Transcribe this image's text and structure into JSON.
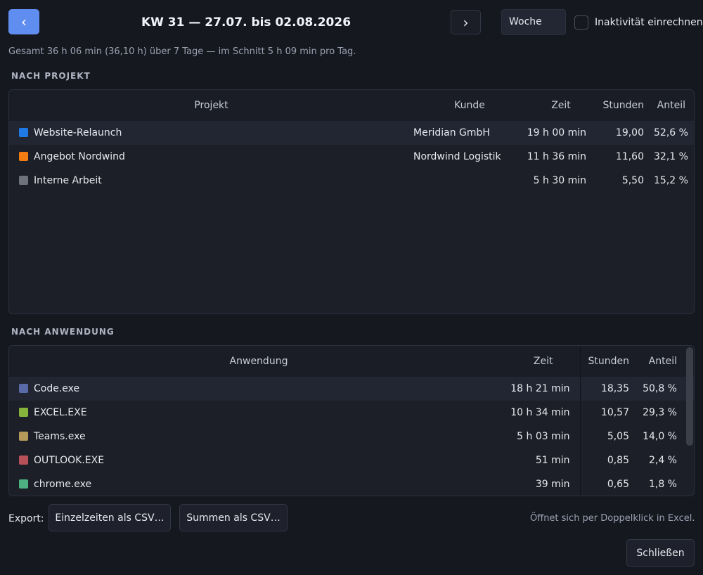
{
  "header": {
    "prev_icon": "‹",
    "next_icon": "›",
    "title": "KW 31 — 27.07. bis 02.08.2026",
    "period": "Woche",
    "inactivity_label": "Inaktivität einrechnen",
    "inactivity_checked": false
  },
  "summary": "Gesamt 36 h 06 min (36,10 h) über 7 Tage — im Schnitt 5 h 09 min pro Tag.",
  "projekt": {
    "section_title": "NACH PROJEKT",
    "columns": [
      "Projekt",
      "Kunde",
      "Zeit",
      "Stunden",
      "Anteil"
    ],
    "rows": [
      {
        "name": "Website-Relaunch",
        "color": "#1f7ae8",
        "kunde": "Meridian GmbH",
        "zeit": "19 h 00 min",
        "stunden": "19,00",
        "anteil": "52,6 %"
      },
      {
        "name": "Angebot Nordwind",
        "color": "#f07c12",
        "kunde": "Nordwind Logistik",
        "zeit": "11 h 36 min",
        "stunden": "11,60",
        "anteil": "32,1 %"
      },
      {
        "name": "Interne Arbeit",
        "color": "#6e727d",
        "kunde": "",
        "zeit": "5 h 30 min",
        "stunden": "5,50",
        "anteil": "15,2 %"
      }
    ]
  },
  "anwendung": {
    "section_title": "NACH ANWENDUNG",
    "columns": [
      "Anwendung",
      "Zeit",
      "Stunden",
      "Anteil"
    ],
    "rows": [
      {
        "name": "Code.exe",
        "color": "#5a6aa8",
        "zeit": "18 h 21 min",
        "stunden": "18,35",
        "anteil": "50,8 %"
      },
      {
        "name": "EXCEL.EXE",
        "color": "#86b33c",
        "zeit": "10 h 34 min",
        "stunden": "10,57",
        "anteil": "29,3 %"
      },
      {
        "name": "Teams.exe",
        "color": "#b59a5a",
        "zeit": "5 h 03 min",
        "stunden": "5,05",
        "anteil": "14,0 %"
      },
      {
        "name": "OUTLOOK.EXE",
        "color": "#b8505a",
        "zeit": "51 min",
        "stunden": "0,85",
        "anteil": "2,4 %"
      },
      {
        "name": "chrome.exe",
        "color": "#4cb080",
        "zeit": "39 min",
        "stunden": "0,65",
        "anteil": "1,8 %"
      }
    ]
  },
  "footer": {
    "export_label": "Export:",
    "csv_single": "Einzelzeiten als CSV…",
    "csv_sum": "Summen als CSV…",
    "hint": "Öffnet sich per Doppelklick in Excel.",
    "close": "Schließen"
  }
}
